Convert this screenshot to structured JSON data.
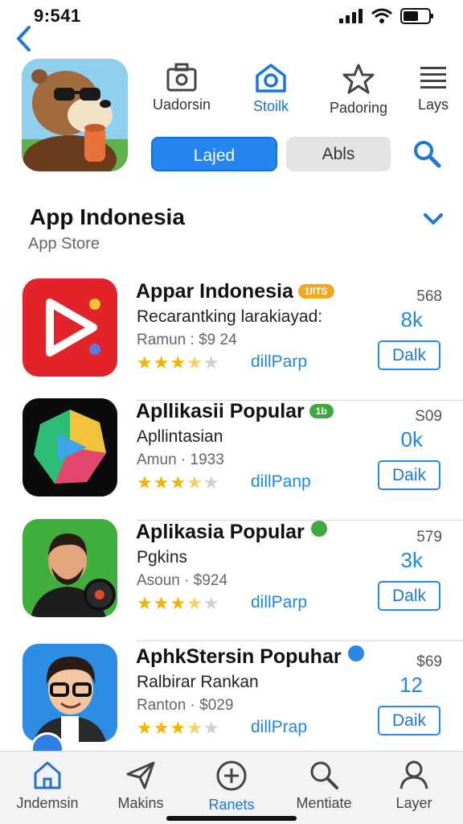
{
  "status": {
    "time": "9:541"
  },
  "top_tabs": [
    {
      "label": "Uadorsin",
      "icon": "camera-icon"
    },
    {
      "label": "Stoilk",
      "icon": "home-camera-icon"
    },
    {
      "label": "Padoring",
      "icon": "star-icon"
    },
    {
      "label": "Lays",
      "icon": "list-icon"
    }
  ],
  "segments": {
    "primary": "Lajed",
    "secondary": "Abls"
  },
  "section": {
    "title": "App Indonesia",
    "subtitle": "App Store"
  },
  "apps": [
    {
      "name": "Appar Indonesia",
      "badge": "1IITS",
      "desc": "Recarantking larakiayad:",
      "meta": "Ramun : $9 24",
      "rating": 3.5,
      "link": "dillParp",
      "price": "568",
      "count": "8k",
      "button": "Dalk"
    },
    {
      "name": "Apllikasii Popular",
      "badge": "1b",
      "desc": "Apllintasian",
      "meta": "Amun · 1933",
      "rating": 3.5,
      "link": "dillPanp",
      "price": "S09",
      "count": "0k",
      "button": "Daik"
    },
    {
      "name": "Aplikasia Popular",
      "badge": "",
      "desc": "Pgkins",
      "meta": "Asoun · $924",
      "rating": 3.5,
      "link": "dillParp",
      "price": "579",
      "count": "3k",
      "button": "Dalk"
    },
    {
      "name": "AphkStersin Popuhar",
      "badge": "",
      "desc": "Ralbirar Rankan",
      "meta": "Ranton · $029",
      "rating": 3.5,
      "link": "dillPrap",
      "price": "$69",
      "count": "12",
      "button": "Daik"
    }
  ],
  "bottom_tabs": [
    {
      "label": "Jndemsin",
      "icon": "home-icon"
    },
    {
      "label": "Makins",
      "icon": "send-icon"
    },
    {
      "label": "Ranets",
      "icon": "plus-circle-icon"
    },
    {
      "label": "Mentiate",
      "icon": "search-icon"
    },
    {
      "label": "Layer",
      "icon": "person-icon"
    }
  ],
  "colors": {
    "accent": "#1e88e5",
    "star": "#f2b400"
  }
}
